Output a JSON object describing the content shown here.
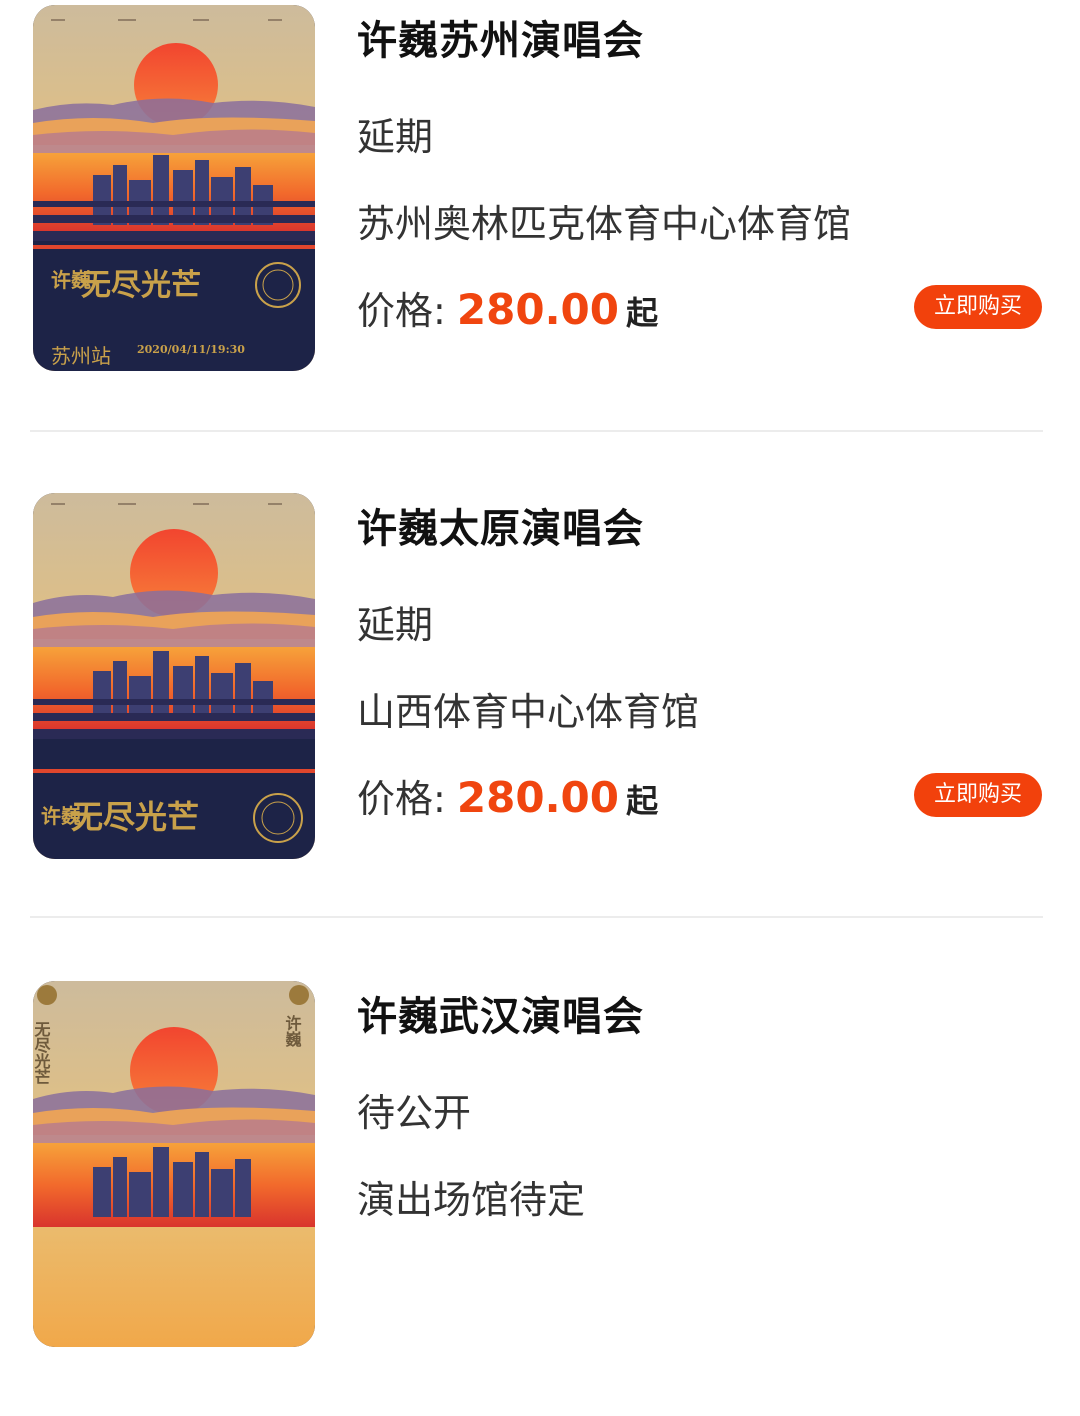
{
  "colors": {
    "accent": "#f2410c",
    "price": "#f0450f",
    "poster_navy": "#1d2347",
    "poster_gold": "#c9a14a"
  },
  "concerts": [
    {
      "title": "许巍苏州演唱会",
      "status": "延期",
      "venue": "苏州奥林匹克体育中心体育馆",
      "price_label": "价格:",
      "price": "280.00",
      "price_suffix": "起",
      "button_label": "立即购买",
      "poster": {
        "name_vertical": "许巍",
        "tour_name": "无尽光芒",
        "city_station": "苏州站",
        "date_time": "2020/04/11/19:30"
      }
    },
    {
      "title": "许巍太原演唱会",
      "status": "延期",
      "venue": "山西体育中心体育馆",
      "price_label": "价格:",
      "price": "280.00",
      "price_suffix": "起",
      "button_label": "立即购买",
      "poster": {
        "name_vertical": "许巍",
        "tour_name": "无尽光芒"
      }
    },
    {
      "title": "许巍武汉演唱会",
      "status": "待公开",
      "venue": "演出场馆待定",
      "poster": {
        "tour_name_vertical": "无尽光芒",
        "name_vertical": "许巍"
      }
    }
  ]
}
